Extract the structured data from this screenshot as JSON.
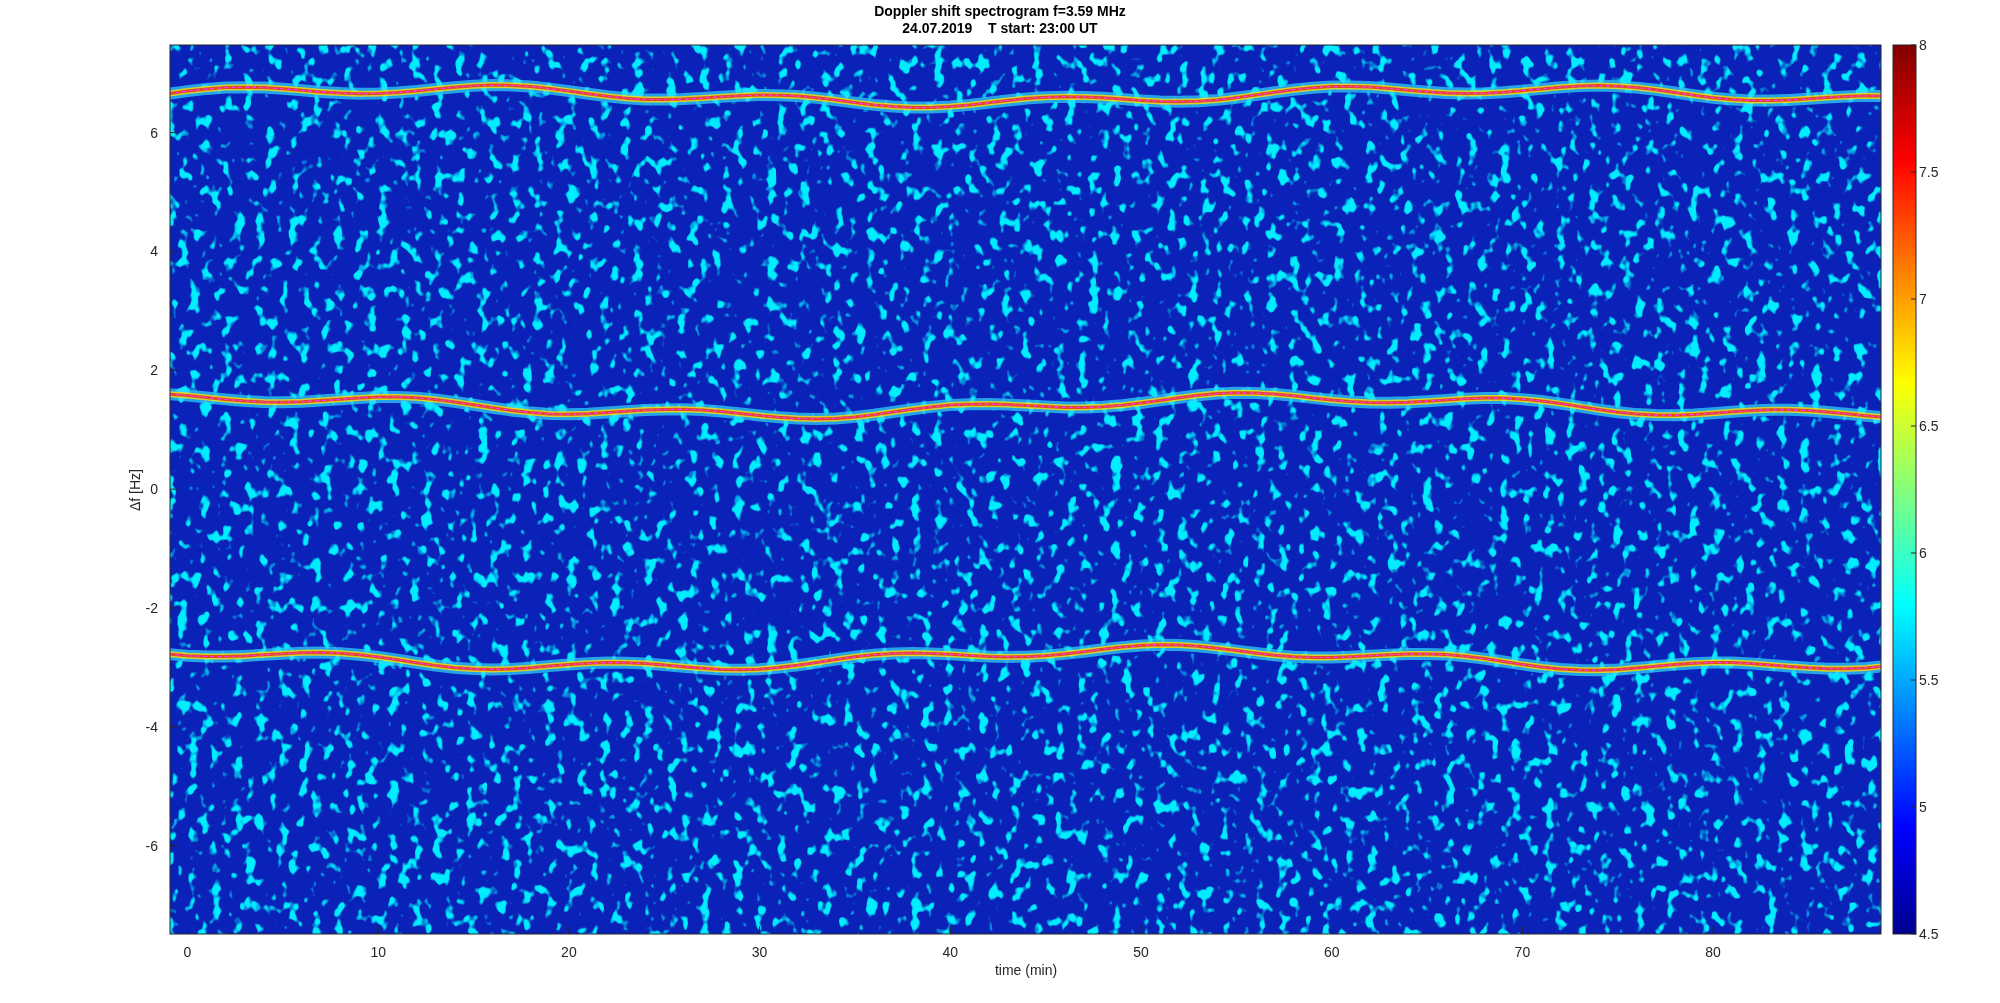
{
  "figure": {
    "title": [
      "Doppler shift spectrogram f=3.59 MHz",
      "24.07.2019    T start: 23:00 UT"
    ],
    "x_axis": {
      "label": "time (min)",
      "ticks": [
        "0",
        "10",
        "20",
        "30",
        "40",
        "50",
        "60",
        "70",
        "80"
      ]
    },
    "y_axis": {
      "label": "Δf [Hz]",
      "ticks": [
        "6",
        "4",
        "2",
        "0",
        "-2",
        "-4",
        "-6"
      ]
    },
    "colorbar": {
      "ticks": [
        "8",
        "7.5",
        "7",
        "6.5",
        "6",
        "5.5",
        "5",
        "4.5"
      ]
    }
  }
}
